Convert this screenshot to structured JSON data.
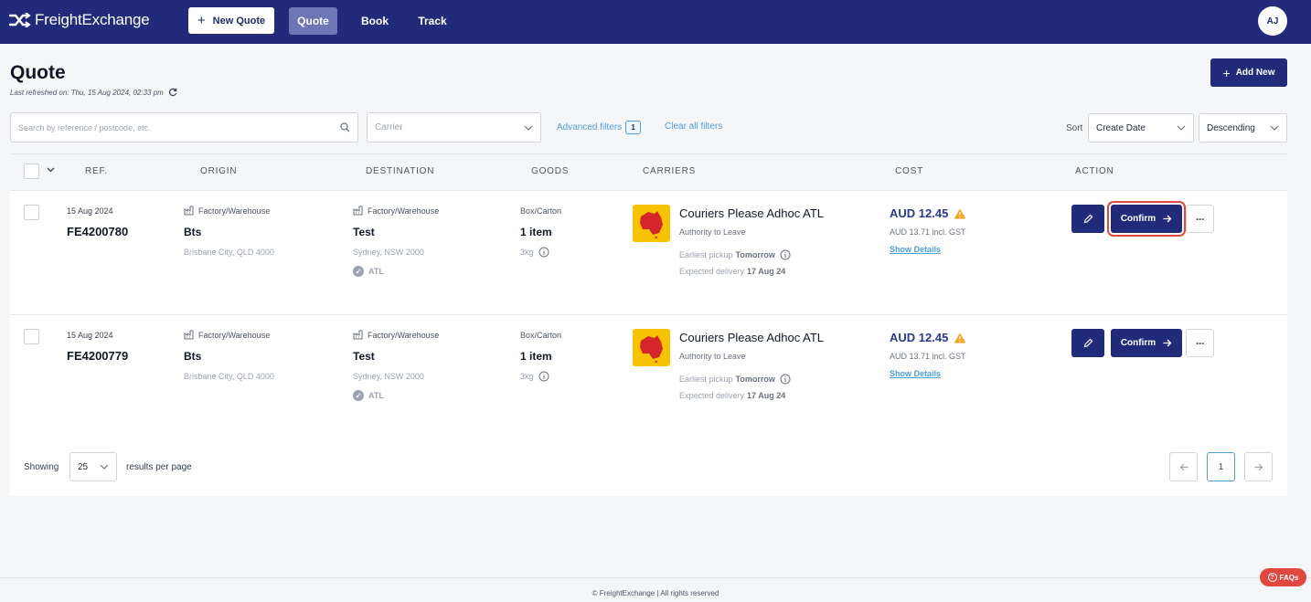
{
  "nav": {
    "logo_text": "FreightExchange",
    "new_quote_label": "New Quote",
    "tabs": [
      "Quote",
      "Book",
      "Track"
    ],
    "avatar_initials": "AJ"
  },
  "header": {
    "title": "Quote",
    "last_refreshed": "Last refreshed on: Thu, 15 Aug 2024, 02:33 pm",
    "add_new_label": "Add New"
  },
  "filters": {
    "search_placeholder": "Search by reference / postcode, etc.",
    "carrier_placeholder": "Carrier",
    "advanced_filters_label": "Advanced filters",
    "advanced_filters_count": "1",
    "clear_all_label": "Clear all filters",
    "sort_label": "Sort",
    "sort_field": "Create Date",
    "sort_order": "Descending"
  },
  "table": {
    "columns": [
      "REF.",
      "ORIGIN",
      "DESTINATION",
      "GOODS",
      "CARRIERS",
      "COST",
      "ACTION"
    ],
    "rows": [
      {
        "date": "15 Aug 2024",
        "ref": "FE4200780",
        "origin": {
          "type": "Factory/Warehouse",
          "name": "Bts",
          "location": "Brisbane City, QLD 4000"
        },
        "destination": {
          "type": "Factory/Warehouse",
          "name": "Test",
          "location": "Sydney, NSW 2000",
          "tag": "ATL"
        },
        "goods": {
          "type": "Box/Carton",
          "qty": "1 item",
          "weight": "3kg"
        },
        "carrier": {
          "name": "Couriers Please Adhoc ATL",
          "service": "Authority to Leave",
          "pickup_label": "Earliest pickup",
          "pickup_value": "Tomorrow",
          "delivery_label": "Expected delivery",
          "delivery_value": "17 Aug 24"
        },
        "cost": {
          "price": "AUD 12.45",
          "incl_gst": "AUD 13.71 incl. GST",
          "details_label": "Show Details"
        },
        "confirm_label": "Confirm",
        "more_label": "···"
      },
      {
        "date": "15 Aug 2024",
        "ref": "FE4200779",
        "origin": {
          "type": "Factory/Warehouse",
          "name": "Bts",
          "location": "Brisbane City, QLD 4000"
        },
        "destination": {
          "type": "Factory/Warehouse",
          "name": "Test",
          "location": "Sydney, NSW 2000",
          "tag": "ATL"
        },
        "goods": {
          "type": "Box/Carton",
          "qty": "1 item",
          "weight": "3kg"
        },
        "carrier": {
          "name": "Couriers Please Adhoc ATL",
          "service": "Authority to Leave",
          "pickup_label": "Earliest pickup",
          "pickup_value": "Tomorrow",
          "delivery_label": "Expected delivery",
          "delivery_value": "17 Aug 24"
        },
        "cost": {
          "price": "AUD 12.45",
          "incl_gst": "AUD 13.71 incl. GST",
          "details_label": "Show Details"
        },
        "confirm_label": "Confirm",
        "more_label": "···"
      }
    ]
  },
  "pagination": {
    "showing_label": "Showing",
    "per_page": "25",
    "per_page_suffix": "results per page",
    "current_page": "1"
  },
  "footer": {
    "copyright": "© FreightExchange | All rights reserved",
    "faqs_label": "FAQs"
  },
  "colors": {
    "nav_bg": "#222b7a",
    "primary": "#222b7a",
    "link": "#4f9fd6",
    "carrier_logo_bg": "#f7c300",
    "warning": "#f5a524",
    "highlight_ring": "#e0483f"
  },
  "icons": [
    "freightexchange-logo-icon",
    "plus-icon",
    "refresh-icon",
    "search-icon",
    "chevron-down-icon",
    "factory-icon",
    "check-circle-icon",
    "info-icon",
    "warning-icon",
    "pencil-icon",
    "arrow-right-icon",
    "arrow-left-icon",
    "question-icon"
  ]
}
